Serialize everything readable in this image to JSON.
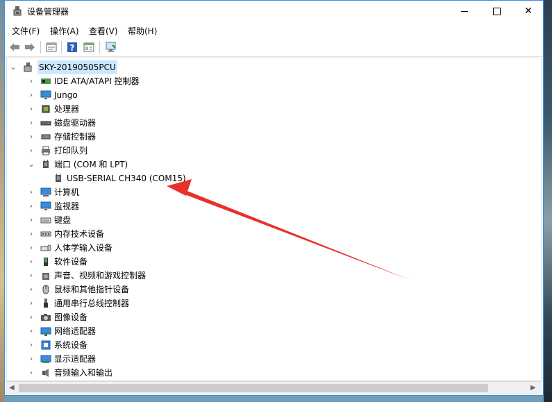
{
  "window": {
    "title": "设备管理器"
  },
  "menu": [
    "文件(F)",
    "操作(A)",
    "查看(V)",
    "帮助(H)"
  ],
  "toolbar_icons": [
    "back-arrow-icon",
    "forward-arrow-icon",
    "properties-icon",
    "help-icon",
    "device-view-icon",
    "scan-hardware-icon"
  ],
  "tree": {
    "root": "SKY-20190505PCU",
    "items": [
      {
        "label": "IDE ATA/ATAPI 控制器",
        "icon": "ide-controller-icon",
        "expanded": false
      },
      {
        "label": "Jungo",
        "icon": "monitor-icon",
        "expanded": false
      },
      {
        "label": "处理器",
        "icon": "processor-icon",
        "expanded": false
      },
      {
        "label": "磁盘驱动器",
        "icon": "disk-drive-icon",
        "expanded": false
      },
      {
        "label": "存储控制器",
        "icon": "storage-controller-icon",
        "expanded": false
      },
      {
        "label": "打印队列",
        "icon": "printer-icon",
        "expanded": false
      },
      {
        "label": "端口 (COM 和 LPT)",
        "icon": "port-icon",
        "expanded": true
      },
      {
        "label": "计算机",
        "icon": "computer-icon",
        "expanded": false
      },
      {
        "label": "监视器",
        "icon": "monitor-icon",
        "expanded": false
      },
      {
        "label": "键盘",
        "icon": "keyboard-icon",
        "expanded": false
      },
      {
        "label": "内存技术设备",
        "icon": "memory-icon",
        "expanded": false
      },
      {
        "label": "人体学输入设备",
        "icon": "hid-icon",
        "expanded": false
      },
      {
        "label": "软件设备",
        "icon": "software-device-icon",
        "expanded": false
      },
      {
        "label": "声音、视频和游戏控制器",
        "icon": "speaker-icon",
        "expanded": false
      },
      {
        "label": "鼠标和其他指针设备",
        "icon": "mouse-icon",
        "expanded": false
      },
      {
        "label": "通用串行总线控制器",
        "icon": "usb-icon",
        "expanded": false
      },
      {
        "label": "图像设备",
        "icon": "camera-icon",
        "expanded": false
      },
      {
        "label": "网络适配器",
        "icon": "network-icon",
        "expanded": false
      },
      {
        "label": "系统设备",
        "icon": "system-device-icon",
        "expanded": false
      },
      {
        "label": "显示适配器",
        "icon": "display-adapter-icon",
        "expanded": false
      },
      {
        "label": "音频输入和输出",
        "icon": "audio-icon",
        "expanded": false
      }
    ],
    "port_child": "USB-SERIAL CH340 (COM15)"
  },
  "colors": {
    "accent": "#3b8fd9",
    "annotation_arrow": "#e8312a"
  }
}
